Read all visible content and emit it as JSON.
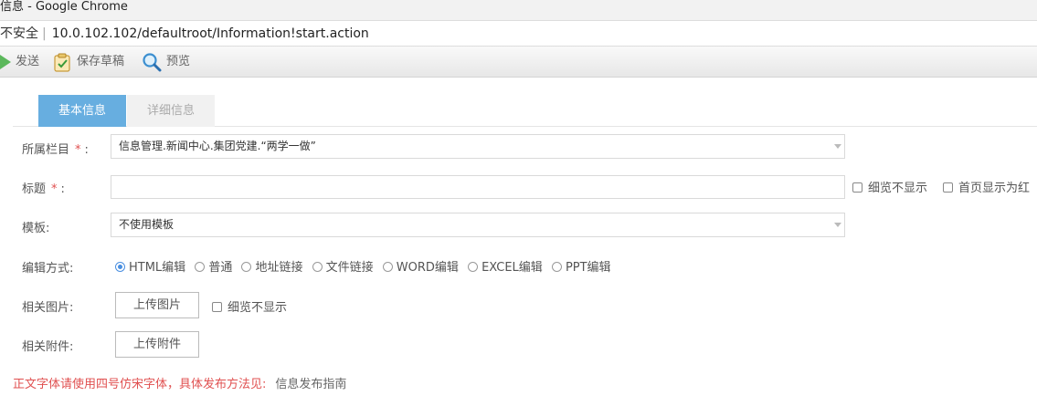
{
  "window": {
    "title": "信息 - Google Chrome"
  },
  "address": {
    "security": "不安全",
    "separator": "|",
    "url": "10.0.102.102/defaultroot/Information!start.action"
  },
  "toolbar": {
    "send": "发送",
    "save_draft": "保存草稿",
    "preview": "预览"
  },
  "tabs": [
    {
      "label": "基本信息"
    },
    {
      "label": "详细信息"
    }
  ],
  "form": {
    "column": {
      "label": "所属栏目",
      "required": "*",
      "colon": ":",
      "value": "信息管理.新闻中心.集团党建.“两学一做”"
    },
    "title": {
      "label": "标题",
      "required": "*",
      "colon": ":",
      "value": ""
    },
    "title_options": {
      "hide_in_browse": "细览不显示",
      "homepage_red": "首页显示为红"
    },
    "template": {
      "label": "模板:",
      "value": "不使用模板"
    },
    "edit_mode": {
      "label": "编辑方式:",
      "options": [
        "HTML编辑",
        "普通",
        "地址链接",
        "文件链接",
        "WORD编辑",
        "EXCEL编辑",
        "PPT编辑"
      ],
      "selected": "HTML编辑"
    },
    "images": {
      "label": "相关图片:",
      "button": "上传图片",
      "hide_in_browse": "细览不显示"
    },
    "attachments": {
      "label": "相关附件:",
      "button": "上传附件"
    }
  },
  "note": {
    "text": "正文字体请使用四号仿宋字体，具体发布方法见:",
    "link": "信息发布指南"
  },
  "colors": {
    "accent": "#67aee0",
    "required": "#e05050",
    "radio": "#4a8fe0"
  }
}
